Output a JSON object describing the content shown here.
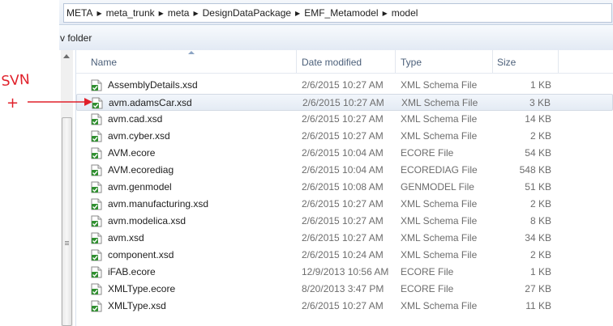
{
  "address": {
    "crumbs": [
      "META",
      "meta_trunk",
      "meta",
      "DesignDataPackage",
      "EMF_Metamodel",
      "model"
    ]
  },
  "toolbar": {
    "new_folder_label": "v folder"
  },
  "columns": {
    "name": "Name",
    "date": "Date modified",
    "type": "Type",
    "size": "Size"
  },
  "files": [
    {
      "name": "AssemblyDetails.xsd",
      "date": "2/6/2015 10:27 AM",
      "type": "XML Schema File",
      "size": "1 KB",
      "icon": "xsd-file-icon"
    },
    {
      "name": "avm.adamsCar.xsd",
      "date": "2/6/2015 10:27 AM",
      "type": "XML Schema File",
      "size": "3 KB",
      "icon": "xsd-file-icon"
    },
    {
      "name": "avm.cad.xsd",
      "date": "2/6/2015 10:27 AM",
      "type": "XML Schema File",
      "size": "14 KB",
      "icon": "xsd-file-icon"
    },
    {
      "name": "avm.cyber.xsd",
      "date": "2/6/2015 10:27 AM",
      "type": "XML Schema File",
      "size": "2 KB",
      "icon": "xsd-file-icon"
    },
    {
      "name": "AVM.ecore",
      "date": "2/6/2015 10:04 AM",
      "type": "ECORE File",
      "size": "54 KB",
      "icon": "ecore-file-icon"
    },
    {
      "name": "AVM.ecorediag",
      "date": "2/6/2015 10:04 AM",
      "type": "ECOREDIAG File",
      "size": "548 KB",
      "icon": "ecorediag-file-icon"
    },
    {
      "name": "avm.genmodel",
      "date": "2/6/2015 10:08 AM",
      "type": "GENMODEL File",
      "size": "51 KB",
      "icon": "genmodel-file-icon"
    },
    {
      "name": "avm.manufacturing.xsd",
      "date": "2/6/2015 10:27 AM",
      "type": "XML Schema File",
      "size": "2 KB",
      "icon": "xsd-file-icon"
    },
    {
      "name": "avm.modelica.xsd",
      "date": "2/6/2015 10:27 AM",
      "type": "XML Schema File",
      "size": "8 KB",
      "icon": "xsd-file-icon"
    },
    {
      "name": "avm.xsd",
      "date": "2/6/2015 10:27 AM",
      "type": "XML Schema File",
      "size": "34 KB",
      "icon": "xsd-file-icon"
    },
    {
      "name": "component.xsd",
      "date": "2/6/2015 10:24 AM",
      "type": "XML Schema File",
      "size": "2 KB",
      "icon": "xsd-file-icon"
    },
    {
      "name": "iFAB.ecore",
      "date": "12/9/2013 10:56 AM",
      "type": "ECORE File",
      "size": "1 KB",
      "icon": "ecore-file-icon"
    },
    {
      "name": "XMLType.ecore",
      "date": "8/20/2013 3:47 PM",
      "type": "ECORE File",
      "size": "27 KB",
      "icon": "ecore-file-icon"
    },
    {
      "name": "XMLType.xsd",
      "date": "2/6/2015 10:27 AM",
      "type": "XML Schema File",
      "size": "11 KB",
      "icon": "xsd-file-icon"
    }
  ],
  "selected_index": 1,
  "annotation": {
    "text": "SVN",
    "plus": "+"
  },
  "colors": {
    "annotation_red": "#e0202a",
    "icon_green": "#2f8f2f"
  }
}
